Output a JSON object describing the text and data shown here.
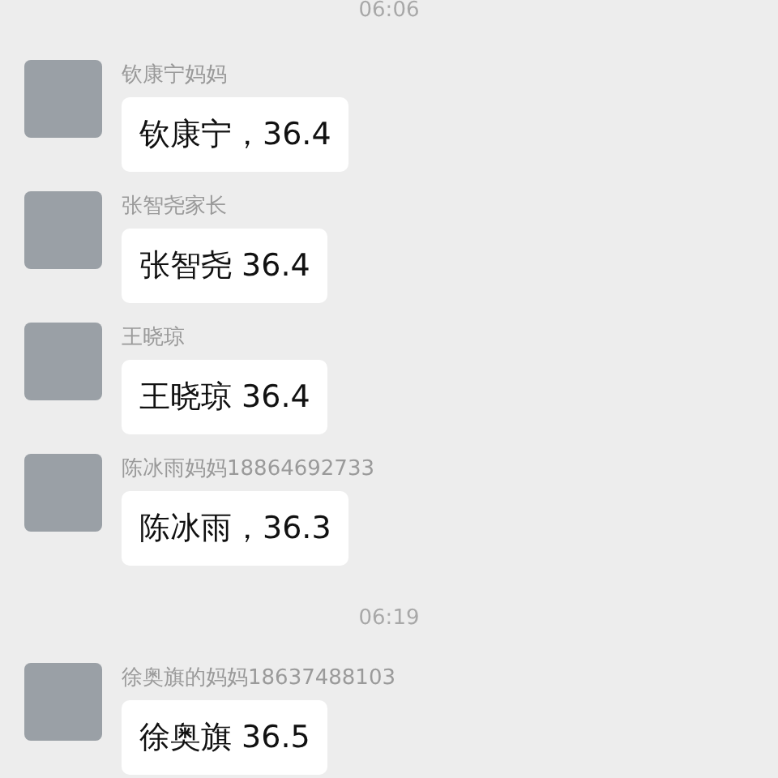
{
  "items": [
    {
      "kind": "time",
      "text": "06:06"
    },
    {
      "kind": "message",
      "sender": "钦康宁妈妈",
      "text": "钦康宁，36.4"
    },
    {
      "kind": "message",
      "sender": "张智尧家长",
      "text": "张智尧 36.4"
    },
    {
      "kind": "message",
      "sender": "王晓琼",
      "text": "王晓琼 36.4"
    },
    {
      "kind": "message",
      "sender": "陈冰雨妈妈18864692733",
      "text": "陈冰雨，36.3"
    },
    {
      "kind": "time",
      "text": "06:19"
    },
    {
      "kind": "message",
      "sender": "徐奥旗的妈妈18637488103",
      "text": "徐奥旗 36.5"
    }
  ]
}
